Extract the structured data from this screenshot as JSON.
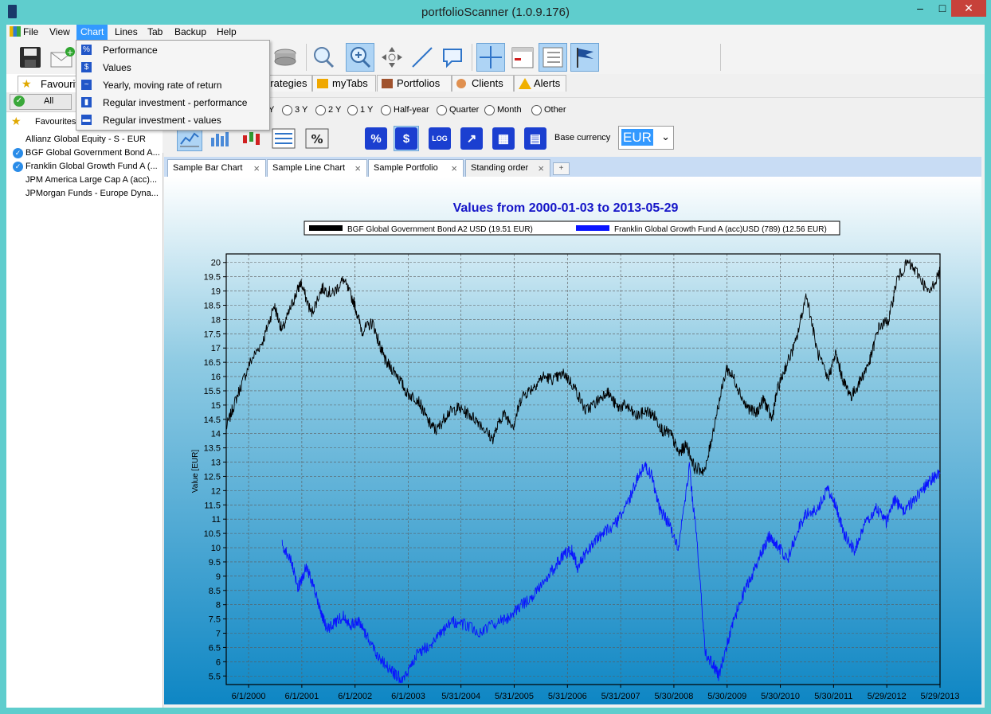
{
  "window": {
    "title": "portfolioScanner (1.0.9.176)",
    "min": "–",
    "max": "□",
    "close": "✕"
  },
  "menu": [
    "File",
    "View",
    "Chart",
    "Lines",
    "Tab",
    "Backup",
    "Help"
  ],
  "chart_menu": [
    {
      "label": "Performance",
      "icon": "%"
    },
    {
      "label": "Values",
      "icon": "$"
    },
    {
      "label": "Yearly, moving rate of return",
      "icon": "~"
    },
    {
      "label": "Regular investment - performance",
      "icon": "▮"
    },
    {
      "label": "Regular investment - values",
      "icon": "▬"
    }
  ],
  "toolbar_icons": [
    "save-icon",
    "mail-add-icon",
    "database-icon",
    "zoom-icon",
    "zoom-in-icon",
    "pan-icon",
    "draw-line-icon",
    "comment-icon",
    "crosshair-icon",
    "calendar-icon",
    "list-icon",
    "flag-icon"
  ],
  "left": {
    "tab": "Favourites",
    "all_button": "All",
    "tree_root": "Favourites",
    "items": [
      {
        "label": "Allianz Global Equity - S - EUR",
        "checked": false
      },
      {
        "label": "BGF Global Government Bond A...",
        "checked": true
      },
      {
        "label": "Franklin Global Growth Fund A (...",
        "checked": true
      },
      {
        "label": "JPM America Large Cap A (acc)...",
        "checked": false
      },
      {
        "label": "JPMorgan Funds - Europe Dyna...",
        "checked": false
      }
    ]
  },
  "tabs": [
    "Strategies",
    "myTabs",
    "Portfolios",
    "Clients",
    "Alerts"
  ],
  "periods": [
    "Y",
    "3 Y",
    "2 Y",
    "1 Y",
    "Half-year",
    "Quarter",
    "Month",
    "Other"
  ],
  "chart_toolbar": {
    "base_currency_label": "Base currency",
    "currency": "EUR",
    "buttons": [
      "%",
      "$",
      "LOG",
      "↗",
      "▦",
      "▤"
    ]
  },
  "doc_tabs": [
    "Sample Bar Chart",
    "Sample Line Chart",
    "Sample Portfolio",
    "Standing order"
  ],
  "chart_data": {
    "type": "line",
    "title": "Values from 2000-01-03 to 2013-05-29",
    "ylabel": "Value [EUR]",
    "ylim": [
      5.2,
      20.3
    ],
    "yticks": [
      5.5,
      6,
      6.5,
      7,
      7.5,
      8,
      8.5,
      9,
      9.5,
      10,
      10.5,
      11,
      11.5,
      12,
      12.5,
      13,
      13.5,
      14,
      14.5,
      15,
      15.5,
      16,
      16.5,
      17,
      17.5,
      18,
      18.5,
      19,
      19.5,
      20
    ],
    "xlim": [
      2000.0,
      2013.41
    ],
    "xtick_labels": [
      "6/1/2000",
      "6/1/2001",
      "6/1/2002",
      "6/1/2003",
      "5/31/2004",
      "5/31/2005",
      "5/31/2006",
      "5/31/2007",
      "5/30/2008",
      "5/30/2009",
      "5/30/2010",
      "5/30/2011",
      "5/29/2012",
      "5/29/2013"
    ],
    "xtick_pos": [
      2000.42,
      2001.42,
      2002.42,
      2003.42,
      2004.41,
      2005.41,
      2006.41,
      2007.41,
      2008.41,
      2009.41,
      2010.41,
      2011.41,
      2012.41,
      2013.41
    ],
    "grid": true,
    "legend_position": "top-center",
    "series": [
      {
        "name": "BGF Global Government Bond A2 USD (19.51 EUR)",
        "color": "#000000",
        "x": [
          2000.0,
          2000.2,
          2000.45,
          2000.7,
          2000.9,
          2001.05,
          2001.25,
          2001.4,
          2001.6,
          2001.8,
          2002.0,
          2002.2,
          2002.4,
          2002.55,
          2002.75,
          2002.9,
          2003.0,
          2003.2,
          2003.4,
          2003.6,
          2003.8,
          2003.95,
          2004.15,
          2004.35,
          2004.55,
          2004.75,
          2005.0,
          2005.2,
          2005.4,
          2005.55,
          2005.75,
          2005.95,
          2006.15,
          2006.35,
          2006.55,
          2006.75,
          2006.95,
          2007.15,
          2007.35,
          2007.5,
          2007.7,
          2007.9,
          2008.05,
          2008.2,
          2008.35,
          2008.5,
          2008.65,
          2008.8,
          2009.0,
          2009.2,
          2009.4,
          2009.55,
          2009.75,
          2009.95,
          2010.1,
          2010.25,
          2010.35,
          2010.5,
          2010.7,
          2010.9,
          2011.1,
          2011.3,
          2011.45,
          2011.6,
          2011.75,
          2011.95,
          2012.1,
          2012.25,
          2012.45,
          2012.6,
          2012.8,
          2013.0,
          2013.2,
          2013.41
        ],
        "y": [
          14.2,
          15.3,
          16.5,
          17.3,
          18.5,
          17.6,
          18.6,
          19.3,
          18.2,
          19.1,
          18.9,
          19.4,
          18.6,
          17.6,
          17.9,
          17.0,
          16.5,
          16.1,
          15.4,
          15.2,
          14.4,
          14.1,
          14.7,
          14.9,
          14.7,
          14.4,
          13.8,
          14.7,
          14.3,
          15.3,
          15.6,
          16.0,
          15.9,
          16.1,
          15.6,
          14.8,
          15.1,
          15.5,
          14.9,
          15.0,
          14.6,
          14.8,
          14.6,
          14.1,
          14.0,
          13.3,
          13.6,
          12.8,
          12.7,
          14.6,
          16.3,
          15.9,
          15.0,
          14.7,
          15.2,
          14.5,
          15.5,
          16.3,
          17.2,
          18.9,
          16.9,
          15.9,
          16.8,
          15.8,
          15.3,
          16.0,
          16.6,
          17.7,
          18.0,
          19.4,
          20.0,
          19.6,
          18.9,
          19.7
        ]
      },
      {
        "name": "Franklin Global Growth Fund A (acc)USD (789) (12.56 EUR)",
        "color": "#0a14ff",
        "x": [
          2001.05,
          2001.2,
          2001.35,
          2001.5,
          2001.6,
          2001.75,
          2001.9,
          2002.05,
          2002.2,
          2002.35,
          2002.5,
          2002.65,
          2002.85,
          2003.05,
          2003.2,
          2003.35,
          2003.55,
          2003.75,
          2004.0,
          2004.25,
          2004.5,
          2004.75,
          2005.0,
          2005.25,
          2005.5,
          2005.75,
          2006.0,
          2006.2,
          2006.35,
          2006.5,
          2006.6,
          2006.75,
          2006.95,
          2007.15,
          2007.35,
          2007.55,
          2007.7,
          2007.85,
          2008.0,
          2008.15,
          2008.3,
          2008.5,
          2008.7,
          2008.85,
          2009.0,
          2009.15,
          2009.25,
          2009.45,
          2009.65,
          2009.85,
          2010.05,
          2010.2,
          2010.35,
          2010.55,
          2010.75,
          2010.9,
          2011.1,
          2011.3,
          2011.45,
          2011.6,
          2011.8,
          2012.0,
          2012.2,
          2012.4,
          2012.55,
          2012.7,
          2012.9,
          2013.1,
          2013.25,
          2013.41
        ],
        "y": [
          10.1,
          9.6,
          8.6,
          9.3,
          8.9,
          7.9,
          7.1,
          7.4,
          7.6,
          7.3,
          7.4,
          6.9,
          6.2,
          5.8,
          5.5,
          5.4,
          6.2,
          6.5,
          6.9,
          7.4,
          7.3,
          7.0,
          7.3,
          7.5,
          7.9,
          8.3,
          8.9,
          9.4,
          9.8,
          9.9,
          9.3,
          9.8,
          10.3,
          10.6,
          10.9,
          11.6,
          12.3,
          12.9,
          12.5,
          11.3,
          10.9,
          10.0,
          12.8,
          10.1,
          6.3,
          5.9,
          5.5,
          6.9,
          8.1,
          8.9,
          9.8,
          10.4,
          10.1,
          9.6,
          10.7,
          11.2,
          11.3,
          12.1,
          11.5,
          10.5,
          9.9,
          10.8,
          11.4,
          10.9,
          11.7,
          11.3,
          11.6,
          12.1,
          12.4,
          12.6
        ]
      }
    ]
  }
}
